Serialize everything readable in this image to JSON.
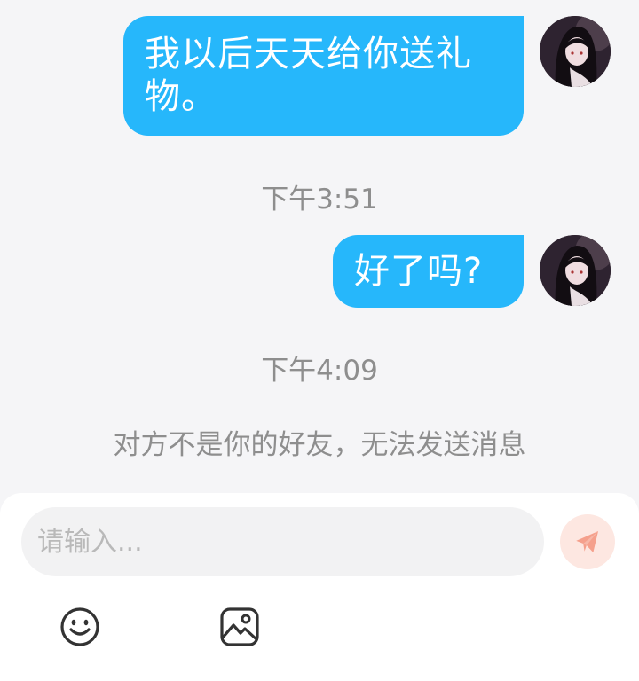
{
  "messages": [
    {
      "side": "right",
      "text": "我以后天天给你送礼物。"
    },
    {
      "side": "right",
      "text": "好了吗?"
    }
  ],
  "timestamps": [
    "下午3:51",
    "下午4:09"
  ],
  "notice": "对方不是你的好友，无法发送消息",
  "composer": {
    "placeholder": "请输入...",
    "send_icon": "send-icon",
    "tools": [
      "emoji-icon",
      "image-icon"
    ]
  },
  "colors": {
    "bubble": "#26b7fb",
    "send_button_disabled": "#fde7e1",
    "send_icon": "#f5a08c"
  }
}
